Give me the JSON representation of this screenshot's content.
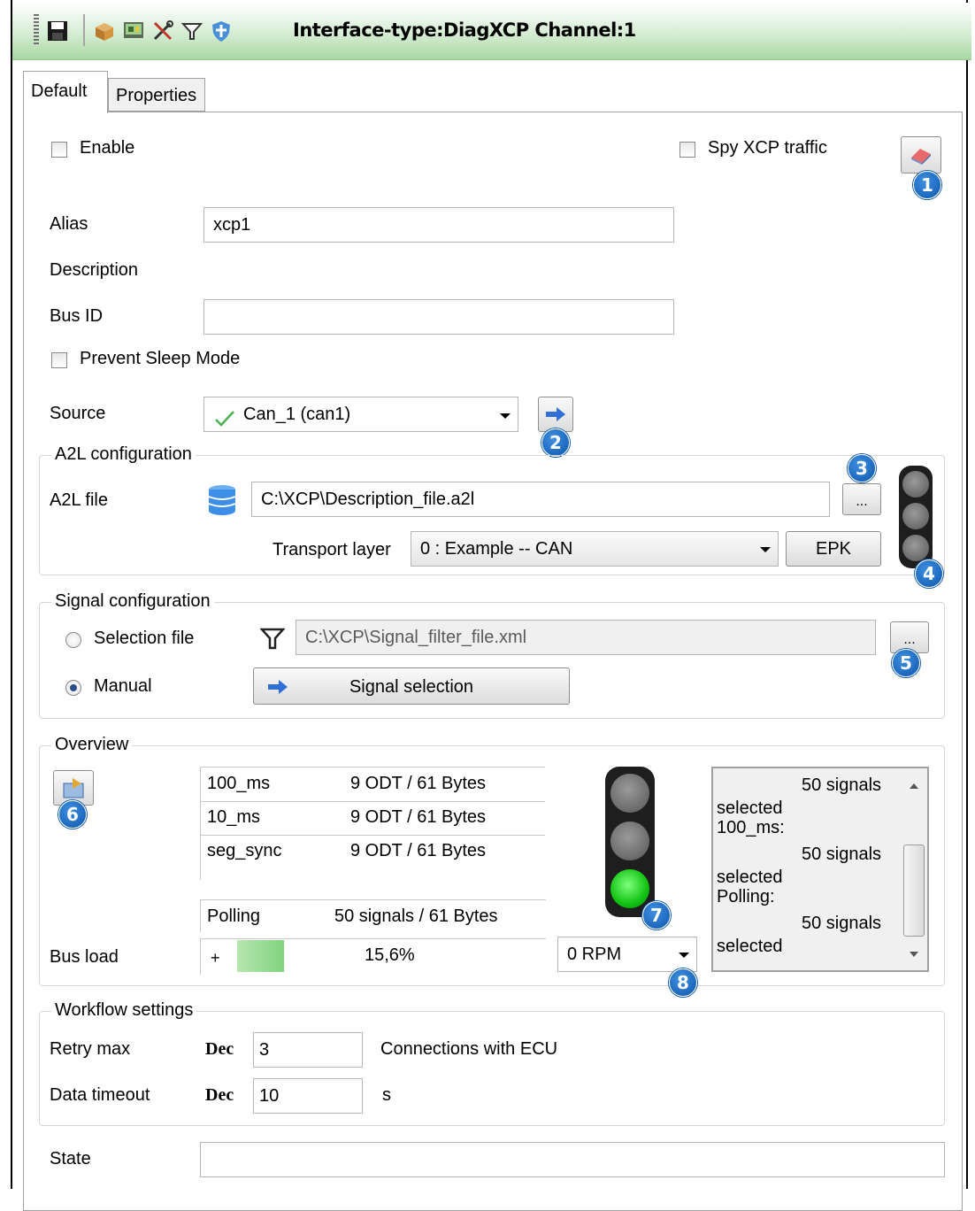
{
  "window": {
    "title": "Interface-type:DiagXCP Channel:1"
  },
  "toolbar": {
    "icons": [
      "save-icon",
      "package-icon",
      "monitor-icon",
      "tools-icon",
      "filter-icon",
      "shield-icon"
    ]
  },
  "tabs": [
    {
      "label": "Default"
    },
    {
      "label": "Properties"
    }
  ],
  "general": {
    "enable_label": "Enable",
    "spy_label": "Spy XCP traffic",
    "alias_label": "Alias",
    "alias_value": "xcp1",
    "description_label": "Description",
    "bus_id_label": "Bus ID",
    "bus_id_value": "",
    "prevent_sleep_label": "Prevent Sleep Mode",
    "source_label": "Source",
    "source_value": "Can_1 (can1)"
  },
  "a2l": {
    "title": "A2L configuration",
    "file_label": "A2L file",
    "file_value": "C:\\XCP\\Description_file.a2l",
    "browse_label": "...",
    "transport_label": "Transport layer",
    "transport_value": "0 : Example  --  CAN",
    "epk_label": "EPK"
  },
  "signal": {
    "title": "Signal configuration",
    "selection_file_label": "Selection file",
    "selection_file_value": "C:\\XCP\\Signal_filter_file.xml",
    "browse_label": "...",
    "manual_label": "Manual",
    "signal_selection_label": "Signal selection"
  },
  "overview": {
    "title": "Overview",
    "rows": [
      {
        "name": "100_ms",
        "info": "9 ODT / 61 Bytes"
      },
      {
        "name": "10_ms",
        "info": "9 ODT / 61 Bytes"
      },
      {
        "name": "seg_sync",
        "info": "9 ODT / 61 Bytes"
      }
    ],
    "polling": {
      "name": "Polling",
      "info": "50 signals / 61 Bytes"
    },
    "bus_load_label": "Bus load",
    "bus_load_plus": "+",
    "bus_load_value": "15,6%",
    "bus_load_fraction": 0.156,
    "rpm_value": "0 RPM",
    "summary": {
      "line1": "50 signals",
      "line2": "selected",
      "line3": "100_ms:",
      "line4": "50 signals",
      "line5": "selected",
      "line6": "Polling:",
      "line7": "50 signals",
      "line8": "selected"
    }
  },
  "workflow": {
    "title": "Workflow settings",
    "retry_label": "Retry max",
    "retry_base": "Dec",
    "retry_value": "3",
    "retry_unit": "Connections with ECU",
    "timeout_label": "Data timeout",
    "timeout_base": "Dec",
    "timeout_value": "10",
    "timeout_unit": "s"
  },
  "state": {
    "label": "State",
    "value": ""
  },
  "badges": [
    "1",
    "2",
    "3",
    "4",
    "5",
    "6",
    "7",
    "8"
  ],
  "colors": {
    "badge": "#0c56ad",
    "green_lamp": "#1bd11b",
    "busload_fill": "#7fd37f",
    "titlebar": "#a6d9a2"
  }
}
